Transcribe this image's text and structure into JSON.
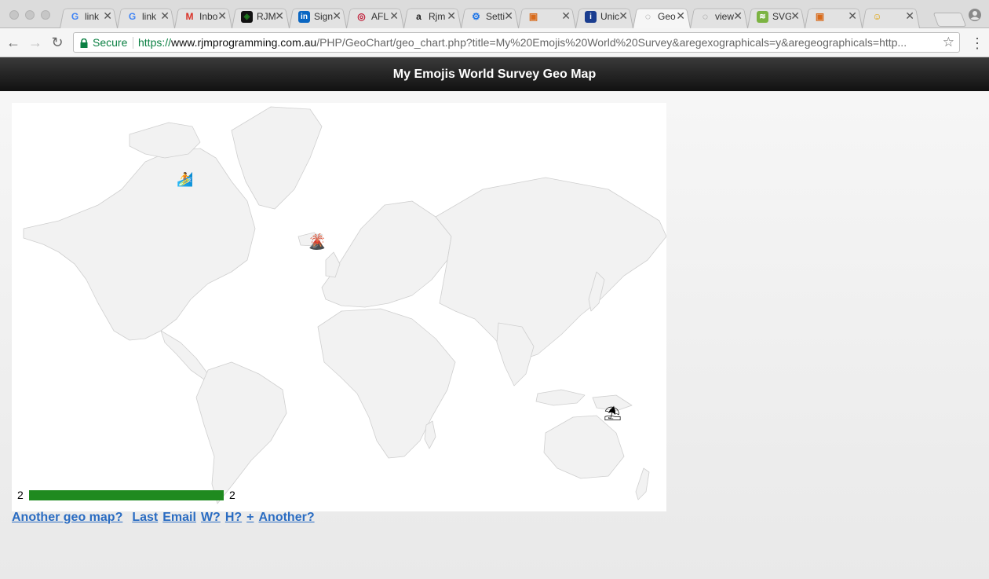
{
  "browser": {
    "tabs": [
      {
        "title": "link",
        "favicon": "google-icon",
        "active": false
      },
      {
        "title": "link",
        "favicon": "google-icon",
        "active": false
      },
      {
        "title": "Inbox",
        "favicon": "gmail-icon",
        "active": false
      },
      {
        "title": "RJM",
        "favicon": "rjm-icon",
        "active": false
      },
      {
        "title": "Sign",
        "favicon": "linkedin-icon",
        "active": false
      },
      {
        "title": "AFL",
        "favicon": "afl-icon",
        "active": false
      },
      {
        "title": "Rjm",
        "favicon": "amazon-icon",
        "active": false
      },
      {
        "title": "Setting",
        "favicon": "gear-icon",
        "active": false
      },
      {
        "title": "",
        "favicon": "shield-video-icon",
        "active": false
      },
      {
        "title": "Unic",
        "favicon": "info-icon",
        "active": false
      },
      {
        "title": "Geo",
        "favicon": "spiral-icon",
        "active": true
      },
      {
        "title": "view",
        "favicon": "spiral-icon",
        "active": false
      },
      {
        "title": "SVG",
        "favicon": "svg-icon",
        "active": false
      },
      {
        "title": "",
        "favicon": "shield-umbrella-icon",
        "active": false
      },
      {
        "title": "",
        "favicon": "heart-eyes-umbrella-icon",
        "active": false
      }
    ],
    "address": {
      "secure_label": "Secure",
      "scheme": "https://",
      "host": "www.rjmprogramming.com.au",
      "path": "/PHP/GeoChart/geo_chart.php?title=My%20Emojis%20World%20Survey&aregexographicals=y&aregeographicals=http..."
    },
    "colors": {
      "secure_green": "#0b8043"
    }
  },
  "page": {
    "title": "My Emojis World Survey Geo Map",
    "markers": [
      {
        "region": "canada-baffin",
        "emoji": "🏄"
      },
      {
        "region": "iceland",
        "emoji": "🌋"
      },
      {
        "region": "new-guinea",
        "emoji": "⛱"
      }
    ],
    "legend": {
      "min": "2",
      "max": "2",
      "color": "#1f8a1f"
    },
    "links": [
      "Another geo map?",
      "Last",
      "Email",
      "W?",
      "H?",
      "+",
      "Another?"
    ]
  }
}
